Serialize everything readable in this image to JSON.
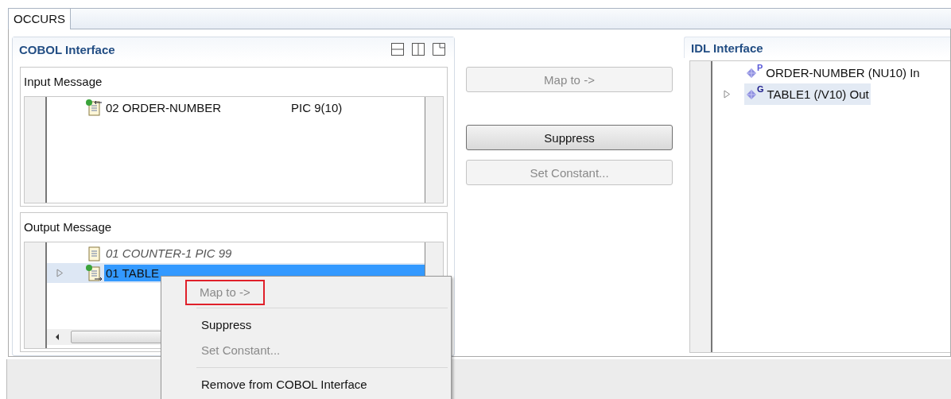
{
  "editor_tab": {
    "label": "OCCURS",
    "selected": true
  },
  "cobol_interface": {
    "title": "COBOL Interface",
    "input_message": {
      "title": "Input Message",
      "rows": [
        {
          "kind": "input",
          "label": "02 ORDER-NUMBER",
          "picture": "PIC 9(10)",
          "expandable": false,
          "selected": false,
          "suppressed": false
        }
      ]
    },
    "output_message": {
      "title": "Output Message",
      "rows": [
        {
          "kind": "plain",
          "label": "01 COUNTER-1 PIC 99",
          "expandable": false,
          "selected": false,
          "suppressed": true
        },
        {
          "kind": "output",
          "label": "01 TABLE",
          "expandable": true,
          "selected": true,
          "suppressed": false
        }
      ]
    }
  },
  "actions": [
    {
      "label": "Map to ->",
      "disabled": true
    },
    {
      "label": "Suppress",
      "disabled": false
    },
    {
      "label": "Set Constant...",
      "disabled": true
    }
  ],
  "idl_interface": {
    "title": "IDL Interface",
    "rows": [
      {
        "badge": "P",
        "label": "ORDER-NUMBER  (NU10)  In",
        "expandable": false,
        "highlighted": false
      },
      {
        "badge": "G",
        "label": "TABLE1  (/V10)  Out",
        "expandable": true,
        "highlighted": true
      }
    ]
  },
  "context_menu": [
    {
      "kind": "item",
      "label": "Map to ->",
      "disabled": true,
      "highlighted": true
    },
    {
      "kind": "separator"
    },
    {
      "kind": "item",
      "label": "Suppress",
      "disabled": false,
      "highlighted": false
    },
    {
      "kind": "item",
      "label": "Set Constant...",
      "disabled": true,
      "highlighted": false
    },
    {
      "kind": "separator"
    },
    {
      "kind": "item",
      "label": "Remove from COBOL Interface",
      "disabled": false,
      "highlighted": false
    }
  ]
}
